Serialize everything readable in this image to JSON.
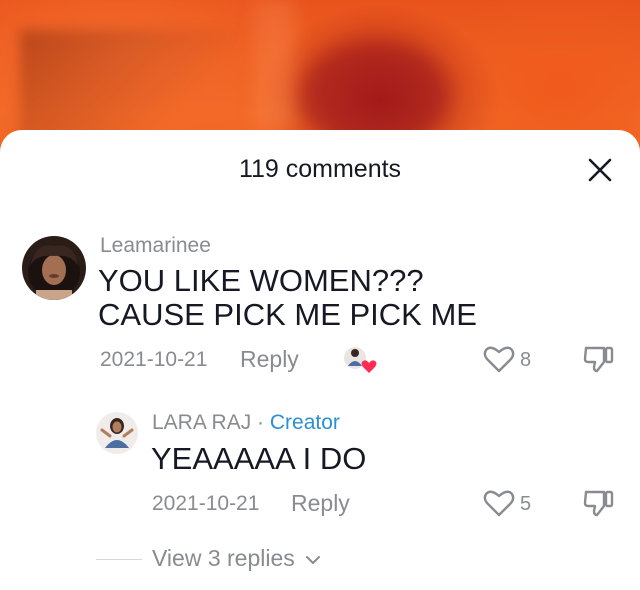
{
  "sheet": {
    "title": "119 comments"
  },
  "comments": [
    {
      "username": "Leamarinee",
      "text": "YOU LIKE WOMEN??? CAUSE PICK ME PICK ME",
      "date": "2021-10-21",
      "reply_label": "Reply",
      "likes": "8",
      "liked_by_creator": true
    }
  ],
  "reply": {
    "username": "LARA RAJ",
    "separator": " · ",
    "creator_label": "Creator",
    "text": "YEAAAAA I DO",
    "date": "2021-10-21",
    "reply_label": "Reply",
    "likes": "5"
  },
  "view_replies": {
    "label": "View 3 replies"
  },
  "colors": {
    "text_primary": "#161823",
    "text_secondary": "#8a8b91",
    "creator_accent": "#2b8fd6",
    "heart_red": "#fe2c55",
    "video_orange": "#f26a26"
  },
  "icons": {
    "close": "close-icon",
    "like": "heart-outline-icon",
    "dislike": "thumbs-down-icon",
    "creator_like": "creator-liked-icon",
    "chevron": "chevron-down-icon"
  }
}
